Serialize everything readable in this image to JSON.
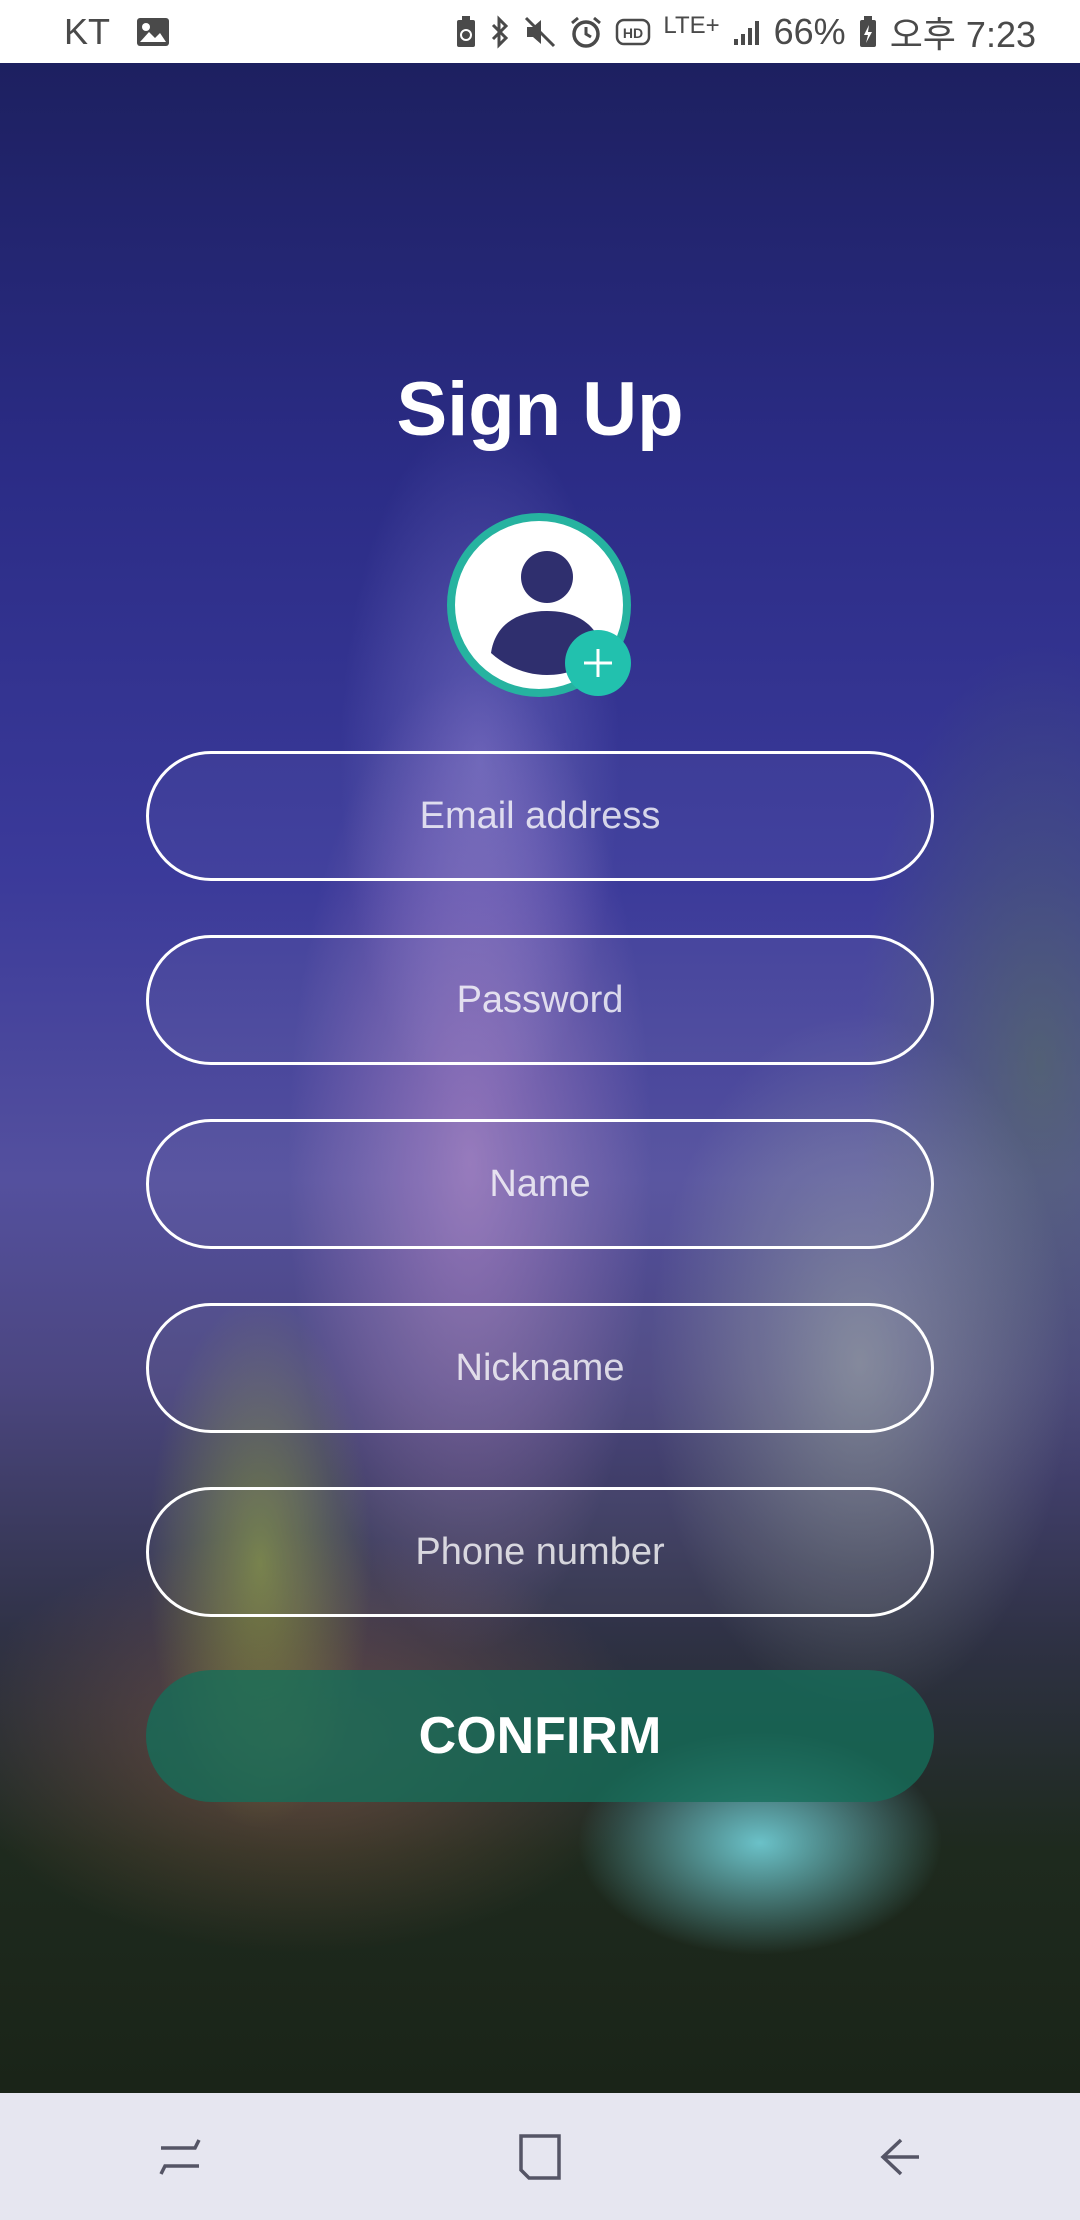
{
  "status_bar": {
    "carrier": "KT",
    "network": "LTE+",
    "battery_percent": "66%",
    "time": "오후 7:23",
    "icons": [
      "image-icon",
      "battery-saver-icon",
      "bluetooth-icon",
      "mute-icon",
      "alarm-icon",
      "hd-voice-icon",
      "signal-icon",
      "battery-icon"
    ]
  },
  "page": {
    "title": "Sign Up"
  },
  "avatar": {
    "icon": "user-icon",
    "add_icon": "plus-icon",
    "accent_color": "#26b3a0"
  },
  "form": {
    "fields": [
      {
        "placeholder": "Email address",
        "value": ""
      },
      {
        "placeholder": "Password",
        "value": ""
      },
      {
        "placeholder": "Name",
        "value": ""
      },
      {
        "placeholder": "Nickname",
        "value": ""
      },
      {
        "placeholder": "Phone number",
        "value": ""
      }
    ],
    "confirm_label": "CONFIRM",
    "confirm_color": "#146e5a"
  },
  "nav_bar": {
    "buttons": [
      "recent-apps-icon",
      "home-icon",
      "back-icon"
    ]
  }
}
